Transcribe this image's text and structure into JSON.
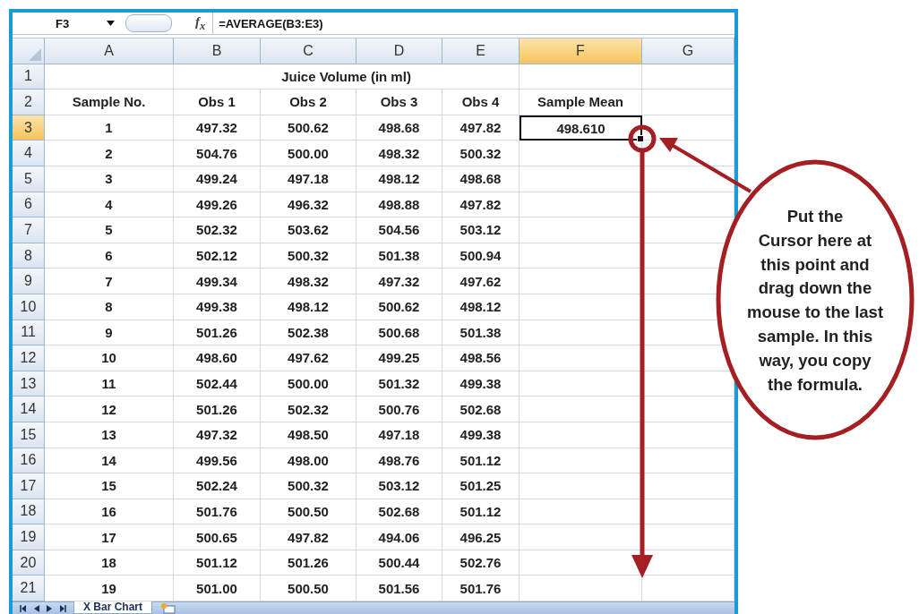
{
  "formula_bar": {
    "name_box": "F3",
    "function_label": "f$_{x}$",
    "formula": "=AVERAGE(B3:E3)"
  },
  "columns": [
    {
      "label": "A",
      "selected": false
    },
    {
      "label": "B",
      "selected": false
    },
    {
      "label": "C",
      "selected": false
    },
    {
      "label": "D",
      "selected": false
    },
    {
      "label": "E",
      "selected": false
    },
    {
      "label": "F",
      "selected": true
    },
    {
      "label": "G",
      "selected": false
    }
  ],
  "title_row": {
    "number": "1",
    "selected": false,
    "title": "Juice Volume (in ml)"
  },
  "header_row": {
    "number": "2",
    "selected": false,
    "cells": [
      "Sample No.",
      "Obs 1",
      "Obs 2",
      "Obs 3",
      "Obs 4",
      "Sample Mean"
    ]
  },
  "rows": [
    {
      "number": "3",
      "selected": true,
      "sample": "1",
      "obs": [
        "497.32",
        "500.62",
        "498.68",
        "497.82"
      ],
      "mean": "498.610"
    },
    {
      "number": "4",
      "selected": false,
      "sample": "2",
      "obs": [
        "504.76",
        "500.00",
        "498.32",
        "500.32"
      ]
    },
    {
      "number": "5",
      "selected": false,
      "sample": "3",
      "obs": [
        "499.24",
        "497.18",
        "498.12",
        "498.68"
      ]
    },
    {
      "number": "6",
      "selected": false,
      "sample": "4",
      "obs": [
        "499.26",
        "496.32",
        "498.88",
        "497.82"
      ]
    },
    {
      "number": "7",
      "selected": false,
      "sample": "5",
      "obs": [
        "502.32",
        "503.62",
        "504.56",
        "503.12"
      ]
    },
    {
      "number": "8",
      "selected": false,
      "sample": "6",
      "obs": [
        "502.12",
        "500.32",
        "501.38",
        "500.94"
      ]
    },
    {
      "number": "9",
      "selected": false,
      "sample": "7",
      "obs": [
        "499.34",
        "498.32",
        "497.32",
        "497.62"
      ]
    },
    {
      "number": "10",
      "selected": false,
      "sample": "8",
      "obs": [
        "499.38",
        "498.12",
        "500.62",
        "498.12"
      ]
    },
    {
      "number": "11",
      "selected": false,
      "sample": "9",
      "obs": [
        "501.26",
        "502.38",
        "500.68",
        "501.38"
      ]
    },
    {
      "number": "12",
      "selected": false,
      "sample": "10",
      "obs": [
        "498.60",
        "497.62",
        "499.25",
        "498.56"
      ]
    },
    {
      "number": "13",
      "selected": false,
      "sample": "11",
      "obs": [
        "502.44",
        "500.00",
        "501.32",
        "499.38"
      ]
    },
    {
      "number": "14",
      "selected": false,
      "sample": "12",
      "obs": [
        "501.26",
        "502.32",
        "500.76",
        "502.68"
      ]
    },
    {
      "number": "15",
      "selected": false,
      "sample": "13",
      "obs": [
        "497.32",
        "498.50",
        "497.18",
        "499.38"
      ]
    },
    {
      "number": "16",
      "selected": false,
      "sample": "14",
      "obs": [
        "499.56",
        "498.00",
        "498.76",
        "501.12"
      ]
    },
    {
      "number": "17",
      "selected": false,
      "sample": "15",
      "obs": [
        "502.24",
        "500.32",
        "503.12",
        "501.25"
      ]
    },
    {
      "number": "18",
      "selected": false,
      "sample": "16",
      "obs": [
        "501.76",
        "500.50",
        "502.68",
        "501.12"
      ]
    },
    {
      "number": "19",
      "selected": false,
      "sample": "17",
      "obs": [
        "500.65",
        "497.82",
        "494.06",
        "496.25"
      ]
    },
    {
      "number": "20",
      "selected": false,
      "sample": "18",
      "obs": [
        "501.12",
        "501.26",
        "500.44",
        "502.76"
      ]
    },
    {
      "number": "21",
      "selected": false,
      "sample": "19",
      "obs": [
        "501.00",
        "500.50",
        "501.56",
        "501.76"
      ]
    }
  ],
  "sheet_tabs": [
    {
      "label": "X Bar Chart",
      "selected": true
    }
  ],
  "callout": {
    "text": "Put the\nCursor here at\nthis point and\ndrag down the\nmouse to the last\nsample. In this\nway, you copy\nthe formula."
  }
}
